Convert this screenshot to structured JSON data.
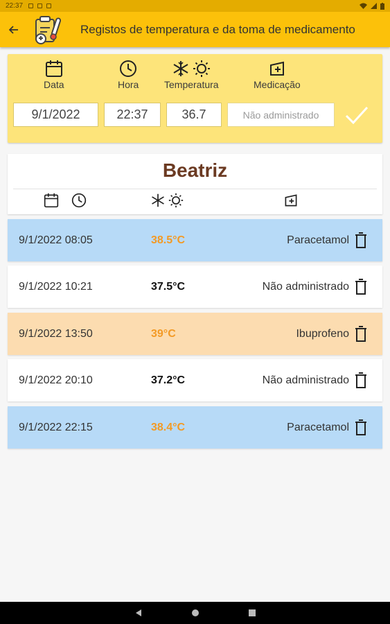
{
  "status_bar": {
    "time": "22:37"
  },
  "app_bar": {
    "title": "Registos de temperatura e da toma de medicamento"
  },
  "entry_form": {
    "headers": {
      "date": "Data",
      "time": "Hora",
      "temperature": "Temperatura",
      "medication": "Medicação"
    },
    "date_value": "9/1/2022",
    "time_value": "22:37",
    "temperature_value": "36.7",
    "medication_placeholder": "Não administrado"
  },
  "patient": {
    "name": "Beatriz"
  },
  "records": [
    {
      "datetime": "9/1/2022 08:05",
      "temperature": "38.5°C",
      "medication": "Paracetamol"
    },
    {
      "datetime": "9/1/2022 10:21",
      "temperature": "37.5°C",
      "medication": "Não administrado"
    },
    {
      "datetime": "9/1/2022 13:50",
      "temperature": "39°C",
      "medication": "Ibuprofeno"
    },
    {
      "datetime": "9/1/2022 20:10",
      "temperature": "37.2°C",
      "medication": "Não administrado"
    },
    {
      "datetime": "9/1/2022 22:15",
      "temperature": "38.4°C",
      "medication": "Paracetamol"
    }
  ],
  "colors": {
    "app_bar": "#fcc10a",
    "form_panel": "#fde47a",
    "paracetamol_row": "#b7daf7",
    "ibuprofeno_row": "#fcdcb0",
    "plain_row": "#ffffff",
    "fever_text": "#f39a25",
    "normal_text": "#111111"
  }
}
